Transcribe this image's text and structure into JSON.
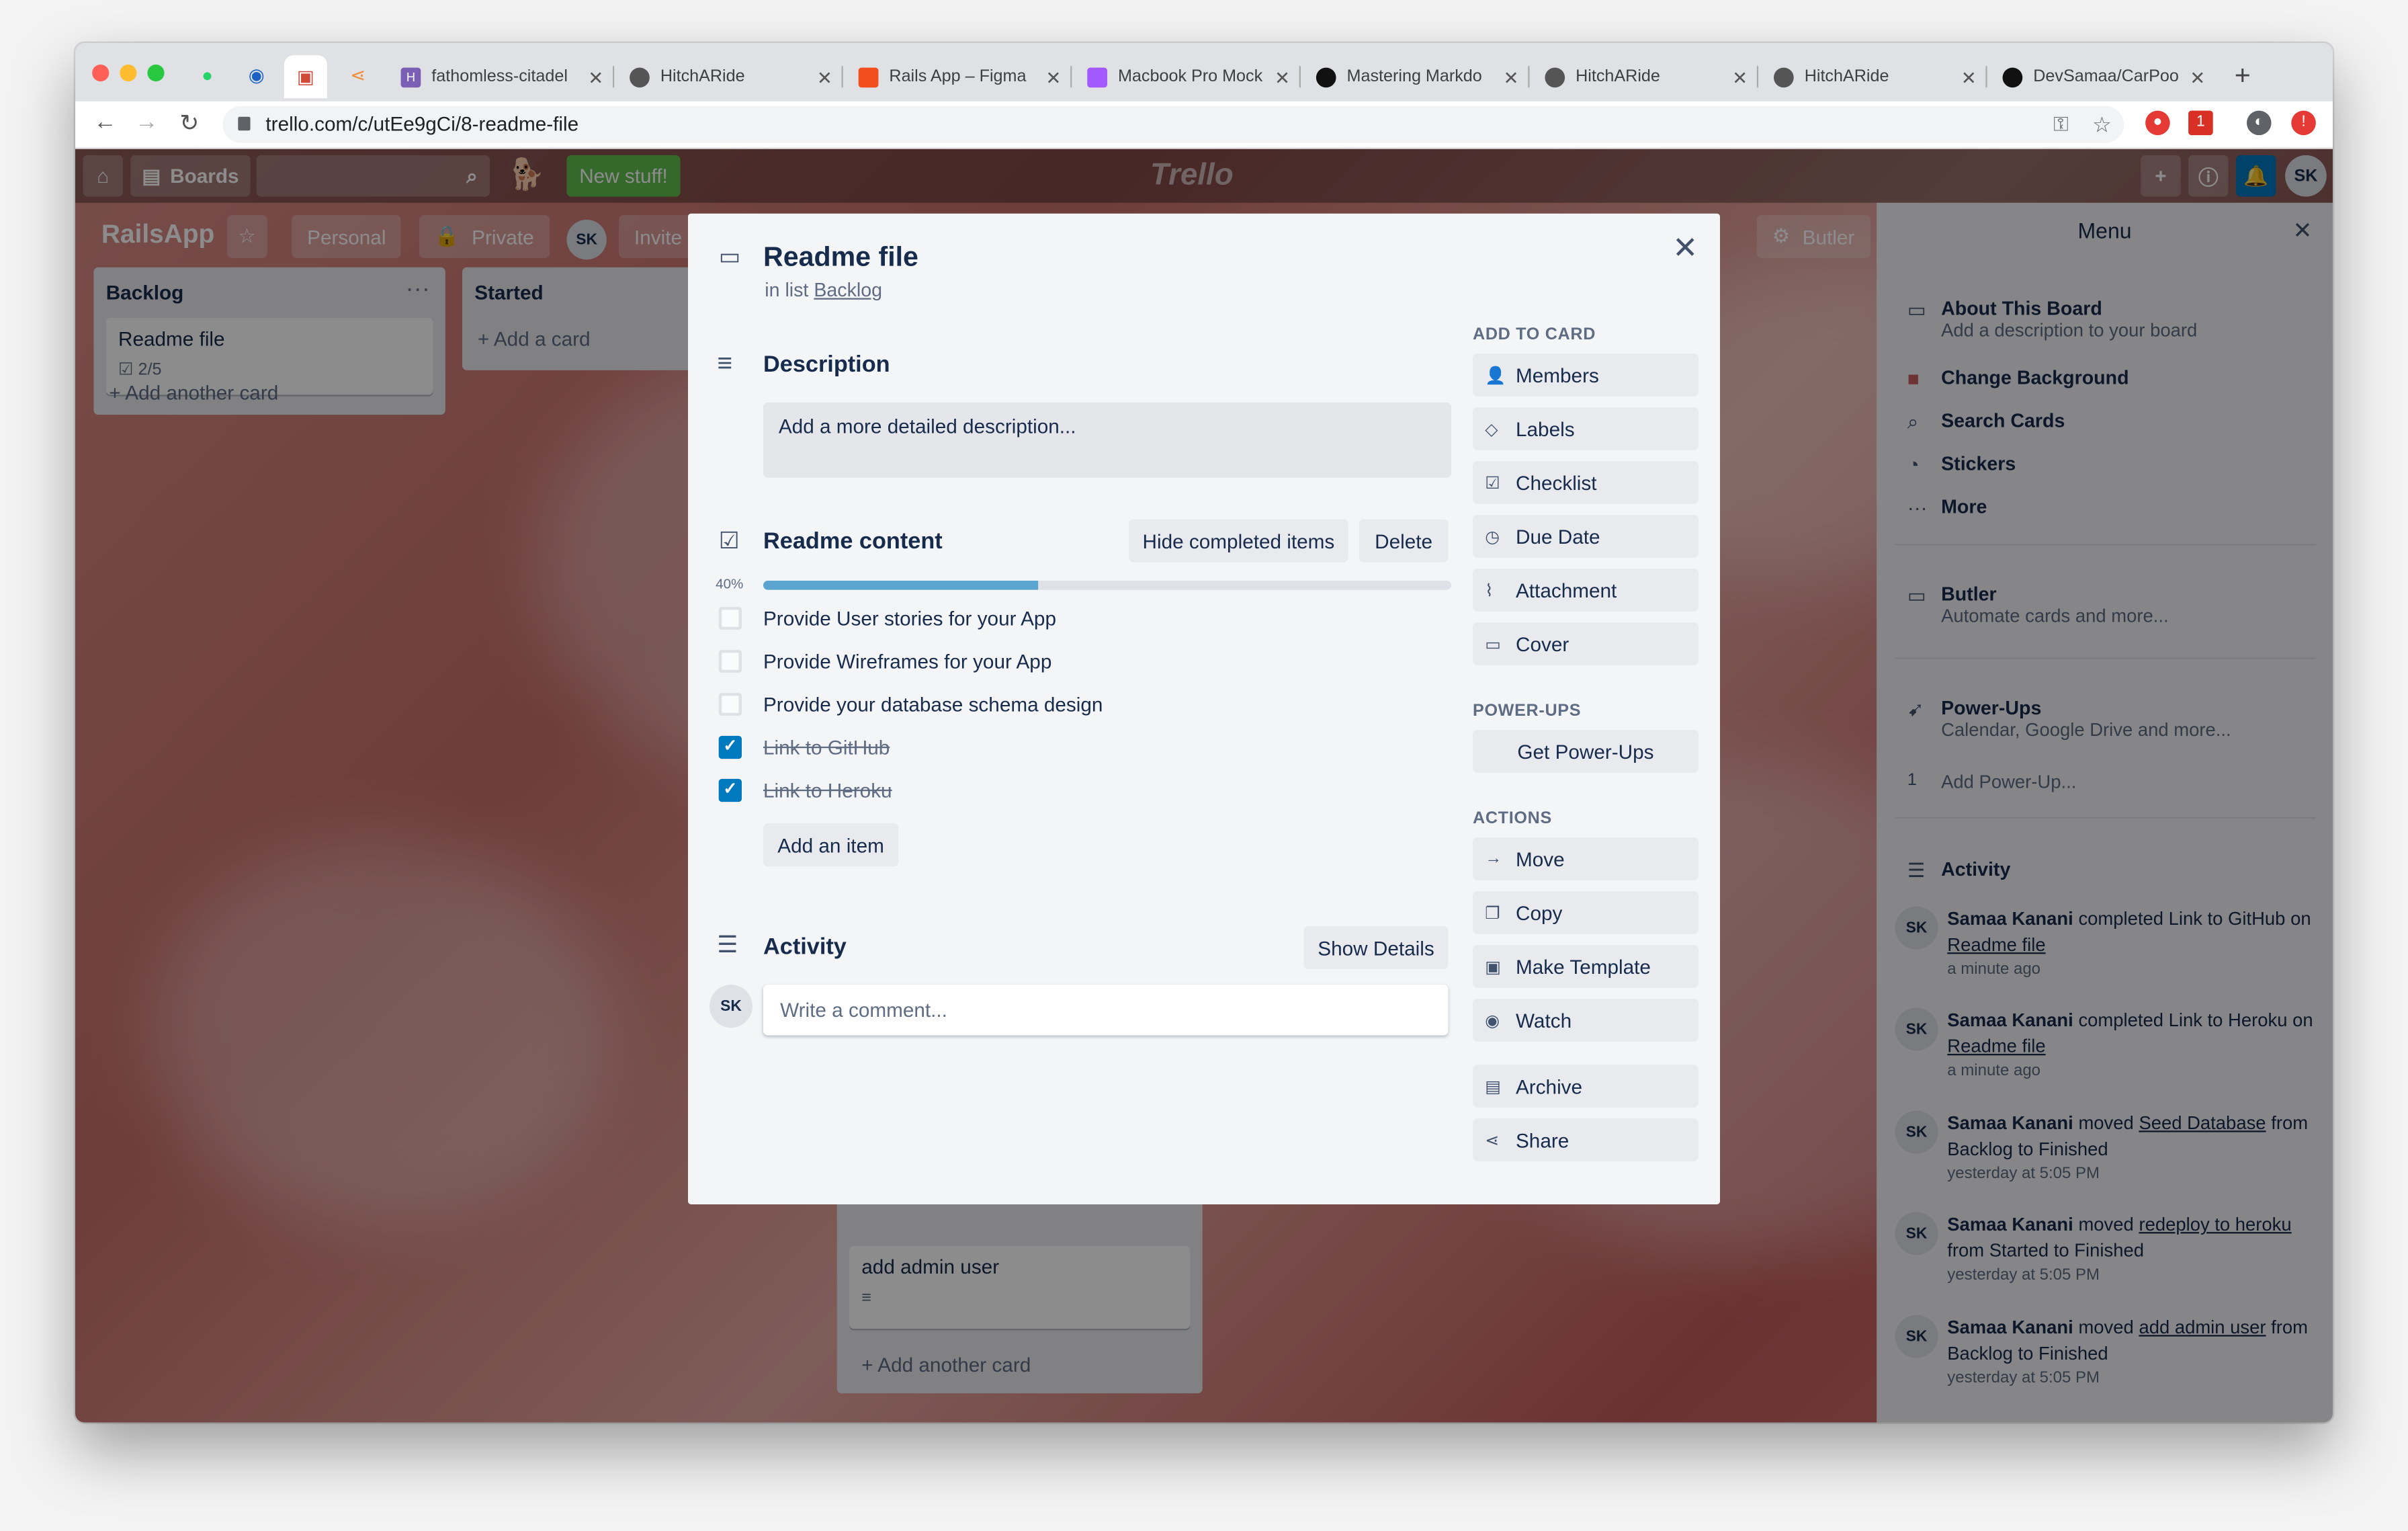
{
  "browser": {
    "tabs": [
      {
        "title": "fathomless-citadel",
        "icon": "heroku-icon"
      },
      {
        "title": "HitchARide",
        "icon": "globe-icon"
      },
      {
        "title": "Rails App – Figma",
        "icon": "figma-icon"
      },
      {
        "title": "Macbook Pro Mock",
        "icon": "figma-icon"
      },
      {
        "title": "Mastering Markdo",
        "icon": "github-icon"
      },
      {
        "title": "HitchARide",
        "icon": "globe-icon"
      },
      {
        "title": "HitchARide",
        "icon": "globe-icon"
      },
      {
        "title": "DevSamaa/CarPoo",
        "icon": "github-icon"
      }
    ],
    "url": "trello.com/c/utEe9gCi/8-readme-file",
    "extension_badge": "1"
  },
  "trello_header": {
    "boards_label": "Boards",
    "new_stuff_label": "New stuff!",
    "logo_text": "Trello",
    "user_initials": "SK"
  },
  "board": {
    "name": "RailsApp",
    "personal_label": "Personal",
    "private_label": "Private",
    "member_initials": "SK",
    "invite_label": "Invite",
    "butler_label": "Butler",
    "lists": [
      {
        "name": "Backlog",
        "cards": [
          {
            "title": "Readme file",
            "badge": "2/5"
          }
        ],
        "add_label": "Add another card"
      },
      {
        "name": "Started",
        "add_label": "Add a card"
      }
    ],
    "finished_card": {
      "title": "add admin user",
      "add_label": "Add another card"
    }
  },
  "menu": {
    "title": "Menu",
    "items": [
      {
        "label": "About This Board",
        "sub": "Add a description to your board"
      },
      {
        "label": "Change Background"
      },
      {
        "label": "Search Cards"
      },
      {
        "label": "Stickers"
      },
      {
        "label": "More"
      }
    ],
    "butler": {
      "label": "Butler",
      "sub": "Automate cards and more..."
    },
    "powerups": {
      "label": "Power-Ups",
      "sub": "Calendar, Google Drive and more...",
      "count": "1",
      "add_label": "Add Power-Up..."
    },
    "activity_label": "Activity",
    "activity": [
      {
        "user": "Samaa Kanani",
        "action": "completed Link to GitHub",
        "prep": "on",
        "link": "Readme file",
        "rest": "",
        "when": "a minute ago"
      },
      {
        "user": "Samaa Kanani",
        "action": "completed Link to Heroku",
        "prep": "on",
        "link": "Readme file",
        "rest": "",
        "when": "a minute ago"
      },
      {
        "user": "Samaa Kanani",
        "action": "moved",
        "prep": "",
        "link": "Seed Database",
        "rest": "from Backlog to Finished",
        "when": "yesterday at 5:05 PM"
      },
      {
        "user": "Samaa Kanani",
        "action": "moved",
        "prep": "",
        "link": "redeploy to heroku",
        "rest": "from Started to Finished",
        "when": "yesterday at 5:05 PM"
      },
      {
        "user": "Samaa Kanani",
        "action": "moved",
        "prep": "",
        "link": "add admin user",
        "rest": "from Backlog to Finished",
        "when": "yesterday at 5:05 PM"
      }
    ]
  },
  "modal": {
    "title": "Readme file",
    "in_list_prefix": "in list",
    "list_name": "Backlog",
    "description_heading": "Description",
    "description_placeholder": "Add a more detailed description...",
    "checklist": {
      "title": "Readme content",
      "hide_label": "Hide completed items",
      "delete_label": "Delete",
      "progress_label": "40%",
      "progress": 0.4,
      "items": [
        {
          "text": "Provide User stories for your App",
          "done": false
        },
        {
          "text": "Provide Wireframes for your App",
          "done": false
        },
        {
          "text": "Provide your database schema design",
          "done": false
        },
        {
          "text": "Link to GitHub",
          "done": true
        },
        {
          "text": "Link to Heroku",
          "done": true
        }
      ],
      "add_item_label": "Add an item"
    },
    "activity_heading": "Activity",
    "show_details_label": "Show Details",
    "comment_placeholder": "Write a comment...",
    "user_initials": "SK",
    "sidebar": {
      "add_to_card_heading": "ADD TO CARD",
      "add_to_card": [
        "Members",
        "Labels",
        "Checklist",
        "Due Date",
        "Attachment",
        "Cover"
      ],
      "powerups_heading": "POWER-UPS",
      "get_powerups_label": "Get Power-Ups",
      "actions_heading": "ACTIONS",
      "actions": [
        "Move",
        "Copy",
        "Make Template",
        "Watch",
        "Archive",
        "Share"
      ]
    }
  },
  "colors": {
    "accent": "#0079bf",
    "progress": "#5ba4cf",
    "new_stuff": "#61bd4f"
  }
}
